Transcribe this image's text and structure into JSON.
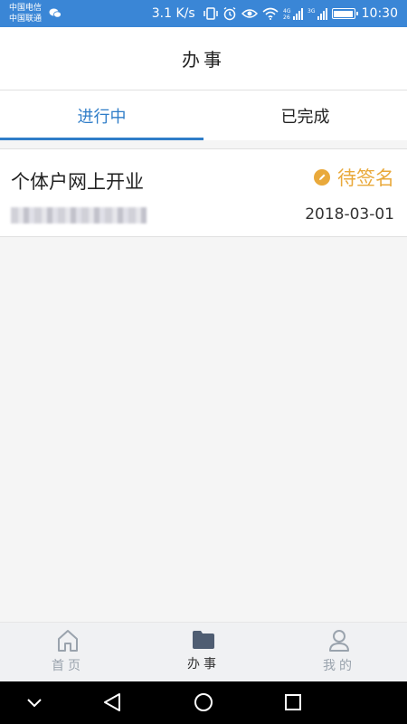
{
  "status_bar": {
    "carrier_1": "中国电信",
    "carrier_2": "中国联通",
    "net_speed": "3.1 K/s",
    "time": "10:30",
    "icons": [
      "wechat-icon",
      "vibrate-icon",
      "alarm-icon",
      "eye-icon",
      "wifi-icon",
      "signal-4g-icon",
      "signal-3g-icon",
      "battery-icon"
    ]
  },
  "header": {
    "title": "办事"
  },
  "tabs": [
    {
      "label": "进行中",
      "active": true
    },
    {
      "label": "已完成",
      "active": false
    }
  ],
  "items": [
    {
      "title": "个体户网上开业",
      "status": "待签名",
      "date": "2018-03-01",
      "status_color": "#e9a93b"
    }
  ],
  "bottom_nav": [
    {
      "label": "首页",
      "icon": "home-icon",
      "active": false
    },
    {
      "label": "办事",
      "icon": "folder-icon",
      "active": true
    },
    {
      "label": "我的",
      "icon": "user-icon",
      "active": false
    }
  ],
  "system_nav": {
    "icons": [
      "collapse-icon",
      "back-icon",
      "home-circle-icon",
      "recents-icon"
    ]
  },
  "colors": {
    "accent": "#2f7dc8",
    "status_bar": "#3a86d6",
    "pending": "#e9a93b"
  }
}
